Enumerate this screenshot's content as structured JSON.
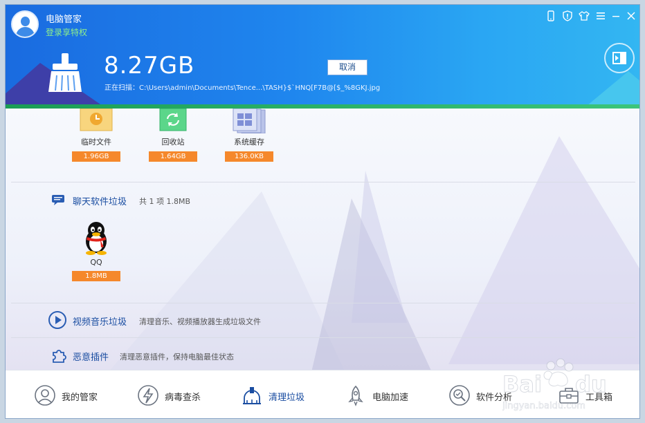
{
  "header": {
    "app_name": "电脑管家",
    "login_text": "登录享特权",
    "scanned_size": "8.27GB",
    "scan_label": "正在扫描：C:\\Users\\admin\\Documents\\Tence...\\TASH}$`HNQ[F7B@[$_%8GKJ.jpg",
    "cancel_label": "取消"
  },
  "cleanup_items": [
    {
      "label": "临时文件",
      "size": "1.96GB",
      "icon": "clock-icon"
    },
    {
      "label": "回收站",
      "size": "1.64GB",
      "icon": "recycle-icon"
    },
    {
      "label": "系统缓存",
      "size": "136.0KB",
      "icon": "windows-cache-icon"
    }
  ],
  "chat_section": {
    "title": "聊天软件垃圾",
    "summary": "共 1 项 1.8MB",
    "items": [
      {
        "label": "QQ",
        "size": "1.8MB",
        "icon": "qq-penguin-icon"
      }
    ]
  },
  "video_section": {
    "title": "视频音乐垃圾",
    "desc": "清理音乐、视频播放器生成垃圾文件"
  },
  "plugin_section": {
    "title": "恶意插件",
    "desc": "清理恶意插件，保持电脑最佳状态"
  },
  "tabs": [
    {
      "label": "我的管家",
      "icon": "butler-icon"
    },
    {
      "label": "病毒查杀",
      "icon": "virus-scan-icon"
    },
    {
      "label": "清理垃圾",
      "icon": "cleanup-icon",
      "active": true
    },
    {
      "label": "电脑加速",
      "icon": "rocket-icon"
    },
    {
      "label": "软件分析",
      "icon": "software-analysis-icon"
    },
    {
      "label": "工具箱",
      "icon": "toolbox-icon"
    }
  ],
  "colors": {
    "header_blue": "#1f86ee",
    "progress_green": "#2bb065",
    "size_bar_orange": "#f5882b",
    "section_title_blue": "#1a4da1"
  }
}
